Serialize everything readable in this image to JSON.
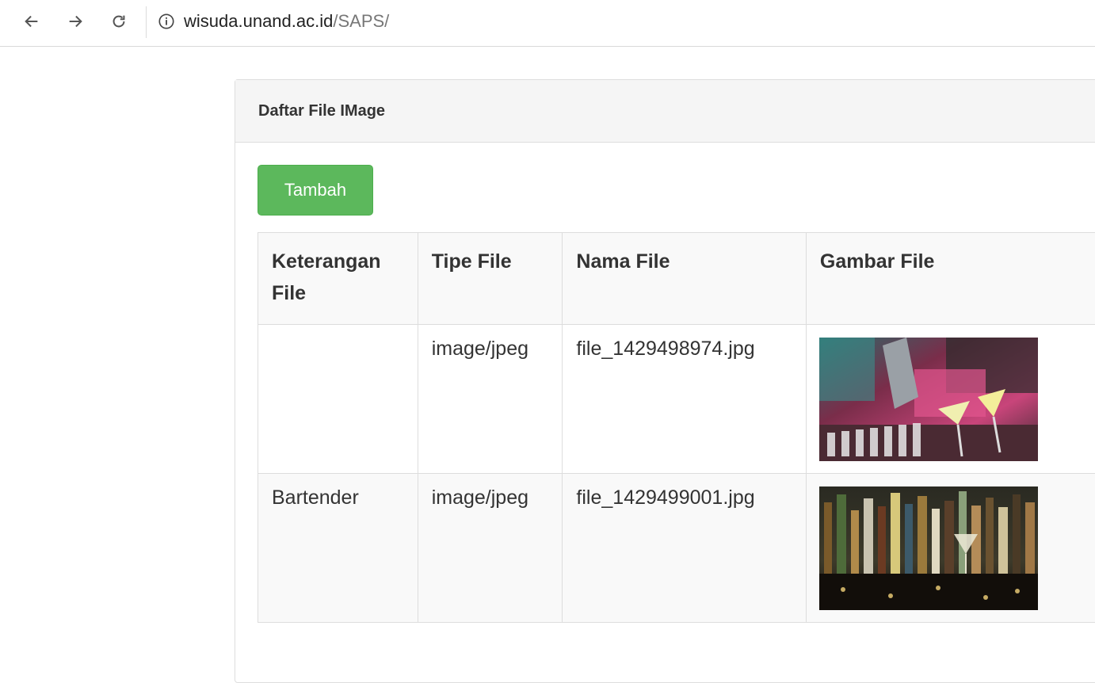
{
  "browser": {
    "url_host": "wisuda.unand.ac.id",
    "url_path": "/SAPS/"
  },
  "panel": {
    "title": "Daftar File IMage",
    "add_button_label": "Tambah"
  },
  "table": {
    "headers": [
      "Keterangan File",
      "Tipe File",
      "Nama File",
      "Gambar File"
    ],
    "rows": [
      {
        "keterangan": "",
        "tipe": "image/jpeg",
        "nama": "file_1429498974.jpg",
        "gambar": "cocktail-pouring-image"
      },
      {
        "keterangan": "Bartender",
        "tipe": "image/jpeg",
        "nama": "file_1429499001.jpg",
        "gambar": "bar-bottles-image"
      }
    ]
  }
}
